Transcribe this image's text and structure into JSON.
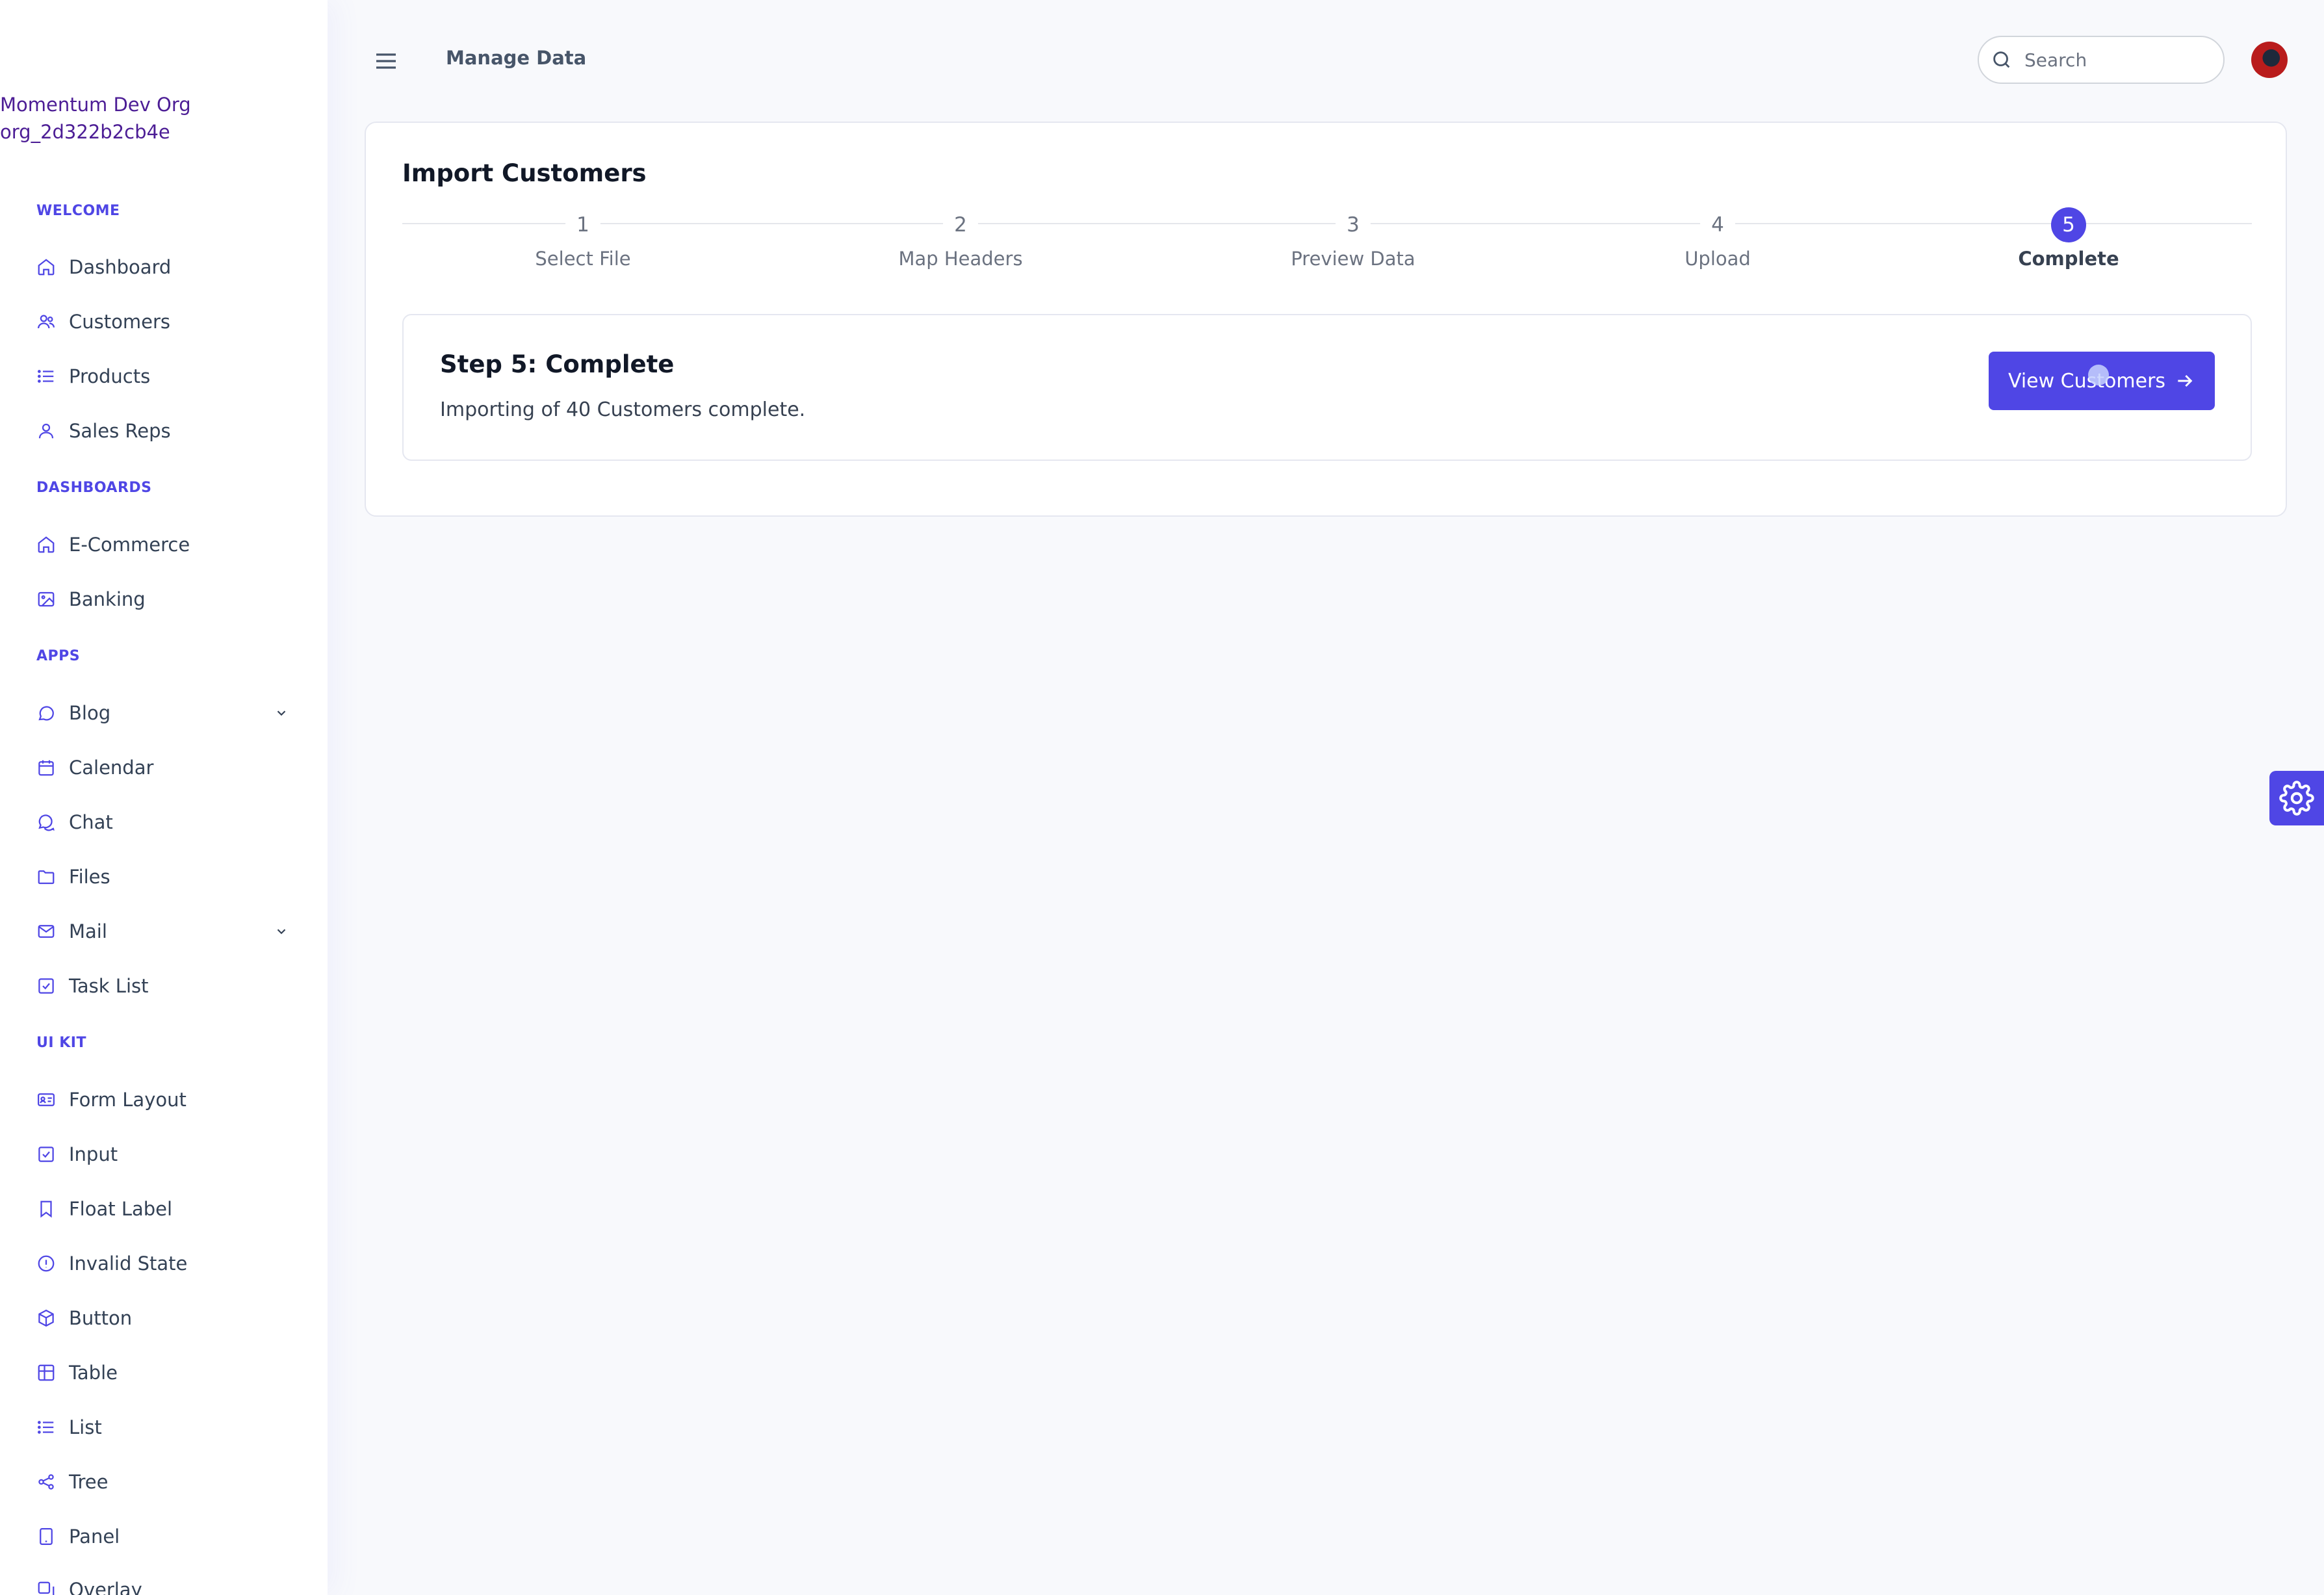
{
  "org": {
    "name": "Momentum Dev Org",
    "id": "org_2d322b2cb4e"
  },
  "sidebar": {
    "sections": {
      "welcome": "WELCOME",
      "dashboards": "DASHBOARDS",
      "apps": "APPS",
      "uikit": "UI KIT"
    },
    "items": {
      "dashboard": "Dashboard",
      "customers": "Customers",
      "products": "Products",
      "sales_reps": "Sales Reps",
      "ecommerce": "E-Commerce",
      "banking": "Banking",
      "blog": "Blog",
      "calendar": "Calendar",
      "chat": "Chat",
      "files": "Files",
      "mail": "Mail",
      "task_list": "Task List",
      "form_layout": "Form Layout",
      "input": "Input",
      "float_label": "Float Label",
      "invalid_state": "Invalid State",
      "button": "Button",
      "table": "Table",
      "list": "List",
      "tree": "Tree",
      "panel": "Panel",
      "overlay": "Overlay"
    }
  },
  "header": {
    "title": "Manage Data",
    "search_placeholder": "Search"
  },
  "import": {
    "title": "Import Customers",
    "steps": [
      {
        "num": "1",
        "label": "Select File"
      },
      {
        "num": "2",
        "label": "Map Headers"
      },
      {
        "num": "3",
        "label": "Preview Data"
      },
      {
        "num": "4",
        "label": "Upload"
      },
      {
        "num": "5",
        "label": "Complete"
      }
    ],
    "active_step": 5,
    "panel": {
      "title": "Step 5: Complete",
      "message": "Importing of 40 Customers complete.",
      "button": "View Customers"
    }
  },
  "colors": {
    "accent": "#4f46e5",
    "section_title": "#4f46e5",
    "org_text": "#4c1d95"
  },
  "icons": [
    "menu-icon",
    "search-icon",
    "gear-icon",
    "arrow-right-icon",
    "chevron-down-icon"
  ]
}
